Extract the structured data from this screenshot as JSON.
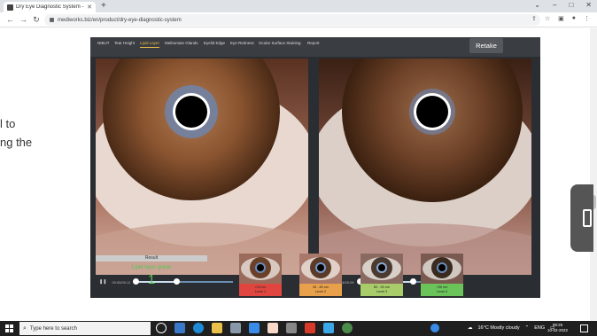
{
  "browser": {
    "tab_title": "Dry Eye Diagnostic System - Me",
    "url": "mediworks.biz/en/product/dry-eye-diagnostic-system"
  },
  "page": {
    "side_text_1": "l to",
    "side_text_2": "ng the"
  },
  "app": {
    "nav": [
      {
        "label": "NIBUT"
      },
      {
        "label": "Tear Height"
      },
      {
        "label": "Lipid Layer"
      },
      {
        "label": "Meibomian Glands"
      },
      {
        "label": "Eyelid Edge"
      },
      {
        "label": "Eye Redness"
      },
      {
        "label": "Ocular Surface Staining"
      },
      {
        "label": "Report"
      }
    ],
    "active_nav": "Lipid Layer",
    "retake_label": "Retake",
    "player_left_time": "00:00/00:11",
    "player_right_time": "00:04/00:09",
    "player_left_progress": 0.42,
    "player_right_progress": 0.55,
    "result_label": "Result",
    "grade_title": "Lipid layer grade",
    "grade_value": "1",
    "levels": [
      {
        "range": "<15 nm",
        "label": "Level 1",
        "color": "#e0463f"
      },
      {
        "range": "30 - 80 nm",
        "label": "Level 2",
        "color": "#e8a04a"
      },
      {
        "range": "80 - 90 nm",
        "label": "Level 3",
        "color": "#a8cc6a"
      },
      {
        "range": ">90 nm",
        "label": "Level 4",
        "color": "#6ac45a"
      }
    ]
  },
  "taskbar": {
    "search_placeholder": "Type here to search",
    "weather": "16°C  Mostly cloudy",
    "lang": "ENG",
    "time": "08:25",
    "date": "10-02-2022"
  },
  "colors": {
    "accent_active": "#e8b84a",
    "grade_green": "#56c65a"
  }
}
